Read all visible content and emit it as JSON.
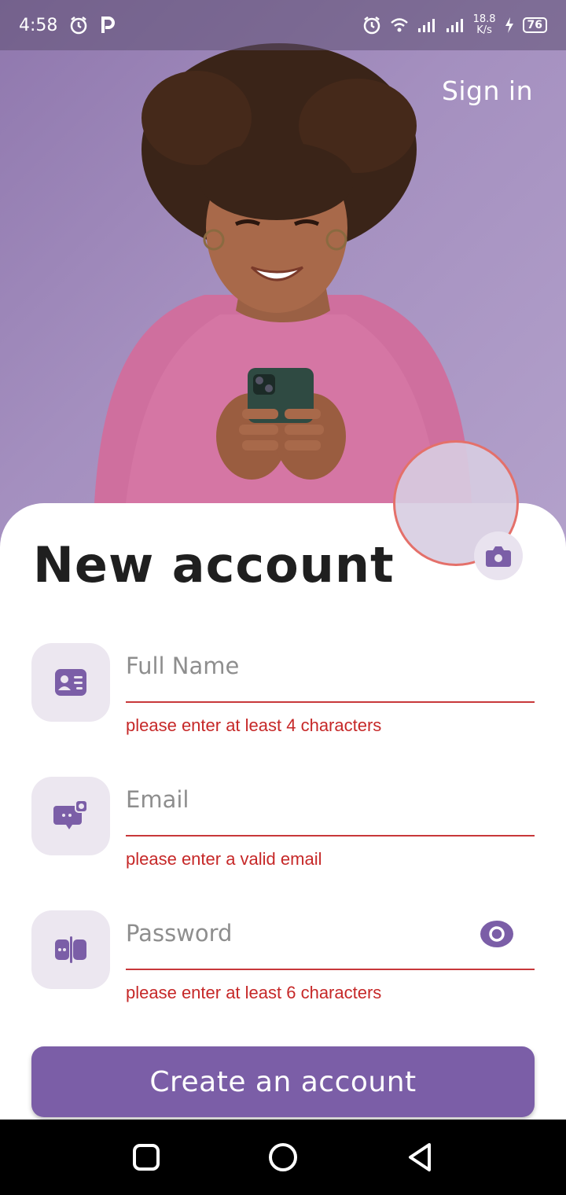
{
  "status_bar": {
    "time": "4:58",
    "speed_value": "18.8",
    "speed_unit": "K/s",
    "battery": "76",
    "icons": [
      "alarm-icon",
      "parking-app-icon",
      "alarm-icon",
      "wifi-icon",
      "signal-icon",
      "signal-icon",
      "charging-icon",
      "battery-icon"
    ]
  },
  "header": {
    "sign_in_label": "Sign in"
  },
  "main": {
    "title": "New account",
    "fields": [
      {
        "placeholder": "Full Name",
        "error": "please enter at least 4 characters",
        "icon": "id-card-icon"
      },
      {
        "placeholder": "Email",
        "error": "please enter a valid email",
        "icon": "message-icon"
      },
      {
        "placeholder": "Password",
        "error": "please enter at least 6 characters",
        "icon": "password-icon"
      }
    ],
    "create_button_label": "Create an account"
  },
  "colors": {
    "accent": "#7b5ea7",
    "error": "#c62828",
    "icon_bg": "#ece7f0",
    "avatar_ring": "#e4706a"
  },
  "nav": {
    "icons": [
      "recents-square-icon",
      "home-circle-icon",
      "back-triangle-icon"
    ]
  }
}
